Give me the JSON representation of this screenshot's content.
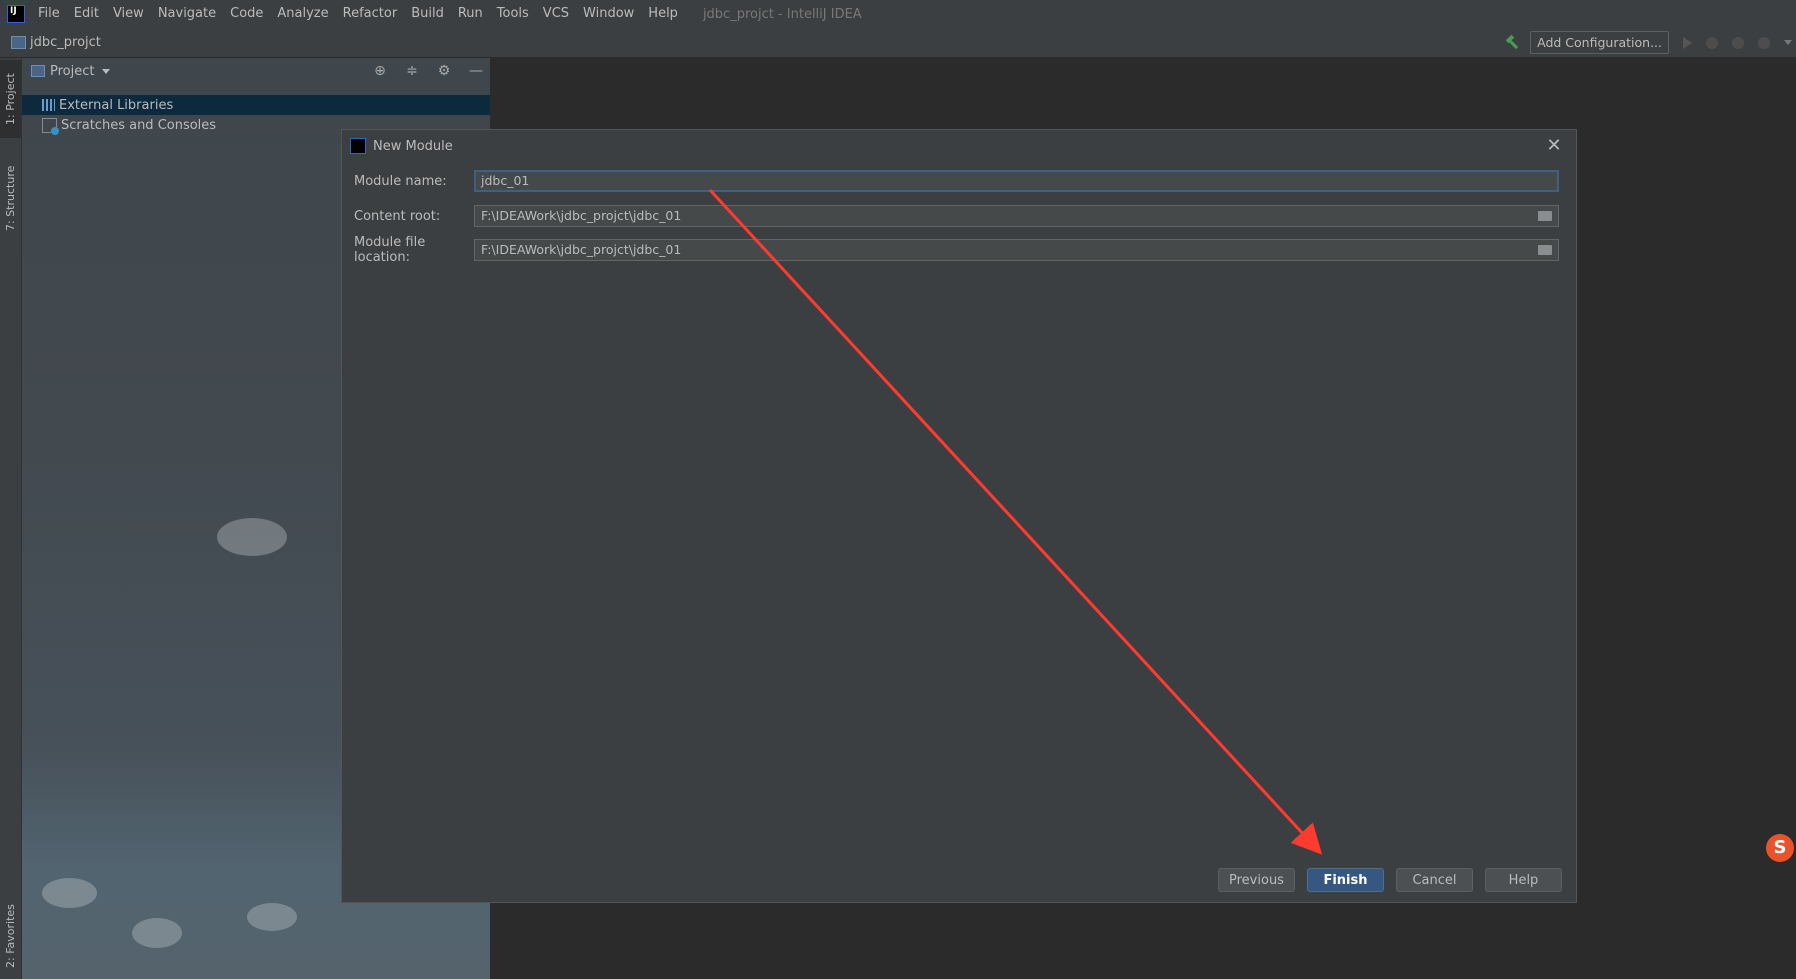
{
  "menubar": {
    "items": [
      "File",
      "Edit",
      "View",
      "Navigate",
      "Code",
      "Analyze",
      "Refactor",
      "Build",
      "Run",
      "Tools",
      "VCS",
      "Window",
      "Help"
    ],
    "window_title": "jdbc_projct - IntelliJ IDEA"
  },
  "navbar": {
    "project_name": "jdbc_projct",
    "add_configuration": "Add Configuration..."
  },
  "left_stripe": {
    "project_tab": "1: Project",
    "structure_tab": "7: Structure",
    "favorites_tab": "2: Favorites"
  },
  "project_panel": {
    "title": "Project",
    "tree": [
      {
        "label": "External Libraries",
        "icon": "library-icon",
        "selected": true
      },
      {
        "label": "Scratches and Consoles",
        "icon": "scratches-icon",
        "selected": false
      }
    ]
  },
  "dialog": {
    "title": "New Module",
    "fields": {
      "module_name_label": "Module name:",
      "module_name_value": "jdbc_01",
      "content_root_label": "Content root:",
      "content_root_value": "F:\\IDEAWork\\jdbc_projct\\jdbc_01",
      "module_file_location_label": "Module file location:",
      "module_file_location_value": "F:\\IDEAWork\\jdbc_projct\\jdbc_01"
    },
    "buttons": {
      "previous": "Previous",
      "finish": "Finish",
      "cancel": "Cancel",
      "help": "Help"
    }
  },
  "colors": {
    "accent_arrow": "#ff3b30",
    "primary_button": "#365880",
    "selection": "#0d293e"
  }
}
